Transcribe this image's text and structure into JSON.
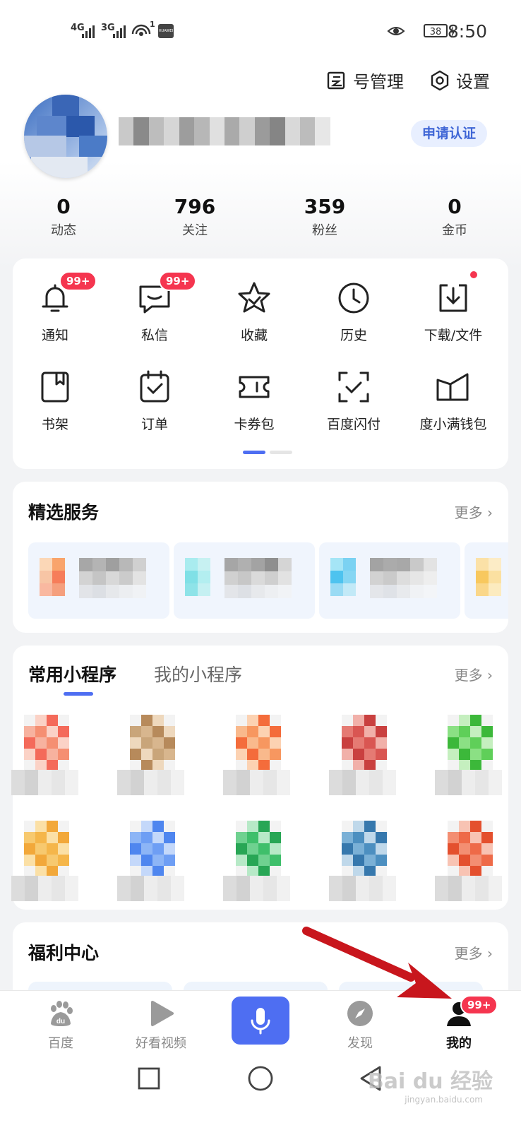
{
  "status_bar": {
    "sig1": "4G",
    "sig2": "3G",
    "wifi_sup": "1",
    "brand": "HUAWEI",
    "battery": "38",
    "time": "8:50"
  },
  "header": {
    "account_manage": "号管理",
    "settings": "设置"
  },
  "profile": {
    "certify_label": "申请认证"
  },
  "stats": [
    {
      "num": "0",
      "label": "动态"
    },
    {
      "num": "796",
      "label": "关注"
    },
    {
      "num": "359",
      "label": "粉丝"
    },
    {
      "num": "0",
      "label": "金币"
    }
  ],
  "tools": {
    "row1": [
      {
        "label": "通知",
        "badge": "99+",
        "icon": "bell-icon"
      },
      {
        "label": "私信",
        "badge": "99+",
        "icon": "message-icon"
      },
      {
        "label": "收藏",
        "icon": "star-icon"
      },
      {
        "label": "历史",
        "icon": "clock-icon"
      },
      {
        "label": "下载/文件",
        "icon": "download-icon"
      }
    ],
    "row2": [
      {
        "label": "书架",
        "icon": "bookshelf-icon"
      },
      {
        "label": "订单",
        "icon": "order-icon"
      },
      {
        "label": "卡券包",
        "icon": "ticket-icon"
      },
      {
        "label": "百度闪付",
        "icon": "scan-pay-icon"
      },
      {
        "label": "度小满钱包",
        "icon": "wallet-icon"
      }
    ]
  },
  "services": {
    "title": "精选服务",
    "more": "更多"
  },
  "mini_programs": {
    "tab_common": "常用小程序",
    "tab_mine": "我的小程序",
    "more": "更多"
  },
  "welfare": {
    "title": "福利中心",
    "more": "更多"
  },
  "bottom_nav": [
    {
      "label": "百度",
      "icon": "baidu-paw-icon"
    },
    {
      "label": "好看视频",
      "icon": "play-icon"
    },
    {
      "label": "",
      "icon": "microphone-icon"
    },
    {
      "label": "发现",
      "icon": "compass-icon"
    },
    {
      "label": "我的",
      "icon": "user-icon",
      "badge": "99+"
    }
  ],
  "watermark": {
    "main": "Bai du 经验",
    "sub": "jingyan.baidu.com"
  },
  "colors": {
    "accent": "#4e6ef2",
    "badge": "#f5354f",
    "annotation_arrow": "#c8161d"
  }
}
